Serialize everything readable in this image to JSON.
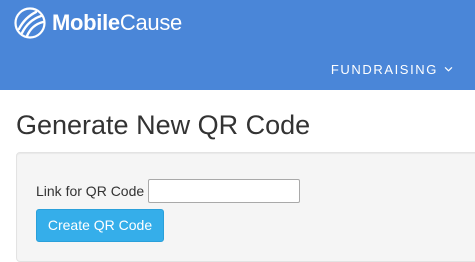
{
  "header": {
    "brand_bold": "Mobile",
    "brand_light": "Cause",
    "nav_label": "FUNDRAISING",
    "nav_icon": "chevron-down-icon",
    "background_color": "#4a86d8"
  },
  "main": {
    "title": "Generate New QR Code",
    "form": {
      "link_label": "Link for QR Code",
      "link_value": "",
      "link_placeholder": "",
      "submit_label": "Create QR Code",
      "submit_color": "#35aeea"
    }
  }
}
